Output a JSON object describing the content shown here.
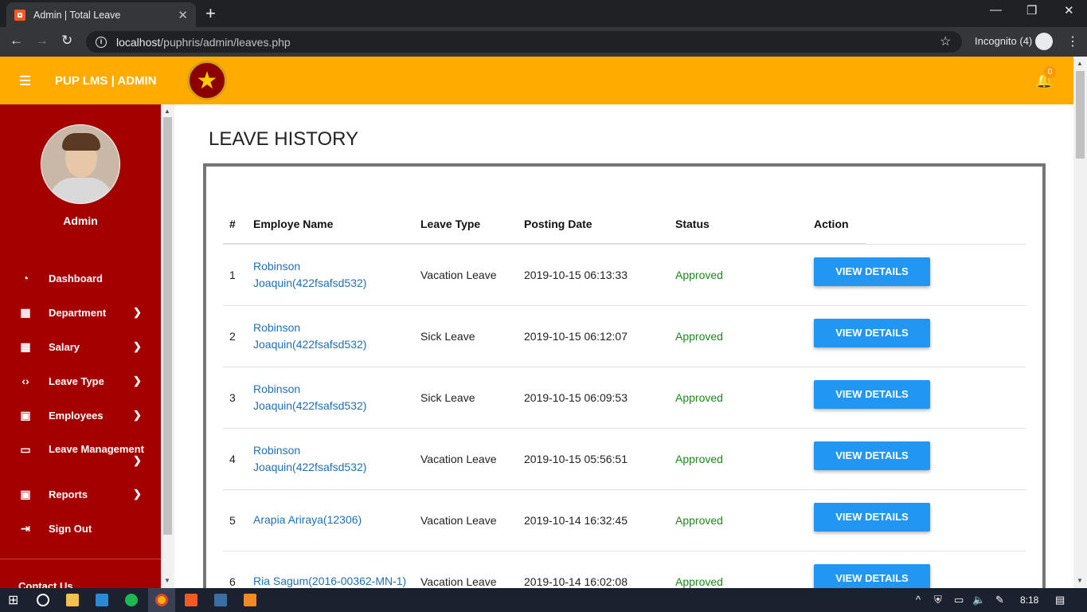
{
  "browser": {
    "tab_title": "Admin | Total Leave",
    "url_host": "localhost",
    "url_path": "/puphris/admin/leaves.php",
    "incognito_label": "Incognito (4)"
  },
  "header": {
    "brand": "PUP LMS | ADMIN",
    "notification_count": "0"
  },
  "sidebar": {
    "user_name": "Admin",
    "items": [
      {
        "label": "Dashboard",
        "icon": "dashboard-icon"
      },
      {
        "label": "Department",
        "icon": "grid-icon"
      },
      {
        "label": "Salary",
        "icon": "grid-icon"
      },
      {
        "label": "Leave Type",
        "icon": "code-icon"
      },
      {
        "label": "Employees",
        "icon": "person-card-icon"
      },
      {
        "label": "Leave Management",
        "icon": "monitor-icon"
      },
      {
        "label": "Reports",
        "icon": "person-card-icon"
      },
      {
        "label": "Sign Out",
        "icon": "sign-out-icon"
      }
    ],
    "contact_label": "Contact Us"
  },
  "main": {
    "title": "LEAVE HISTORY",
    "columns": [
      "#",
      "Employe Name",
      "Leave Type",
      "Posting Date",
      "Status",
      "Action"
    ],
    "rows": [
      {
        "num": "1",
        "name_line1": "Robinson",
        "name_line2": "Joaquin(422fsafsd532)",
        "type": "Vacation Leave",
        "date": "2019-10-15 06:13:33",
        "status": "Approved",
        "action": "VIEW DETAILS"
      },
      {
        "num": "2",
        "name_line1": "Robinson",
        "name_line2": "Joaquin(422fsafsd532)",
        "type": "Sick Leave",
        "date": "2019-10-15 06:12:07",
        "status": "Approved",
        "action": "VIEW DETAILS"
      },
      {
        "num": "3",
        "name_line1": "Robinson",
        "name_line2": "Joaquin(422fsafsd532)",
        "type": "Sick Leave",
        "date": "2019-10-15 06:09:53",
        "status": "Approved",
        "action": "VIEW DETAILS"
      },
      {
        "num": "4",
        "name_line1": "Robinson",
        "name_line2": "Joaquin(422fsafsd532)",
        "type": "Vacation Leave",
        "date": "2019-10-15 05:56:51",
        "status": "Approved",
        "action": "VIEW DETAILS"
      },
      {
        "num": "5",
        "name_line1": "Arapia Ariraya(12306)",
        "name_line2": "",
        "type": "Vacation Leave",
        "date": "2019-10-14 16:32:45",
        "status": "Approved",
        "action": "VIEW DETAILS"
      },
      {
        "num": "6",
        "name_line1": "Ria Sagum(2016-00362-MN-1)",
        "name_line2": "",
        "type": "Vacation Leave",
        "date": "2019-10-14 16:02:08",
        "status": "Approved",
        "action": "VIEW DETAILS"
      }
    ]
  },
  "taskbar": {
    "time": "8:18"
  },
  "colors": {
    "header": "#ffab00",
    "sidebar": "#a50000",
    "button": "#2196f3",
    "approved": "#1b8a1b",
    "link": "#1f6fb5"
  }
}
